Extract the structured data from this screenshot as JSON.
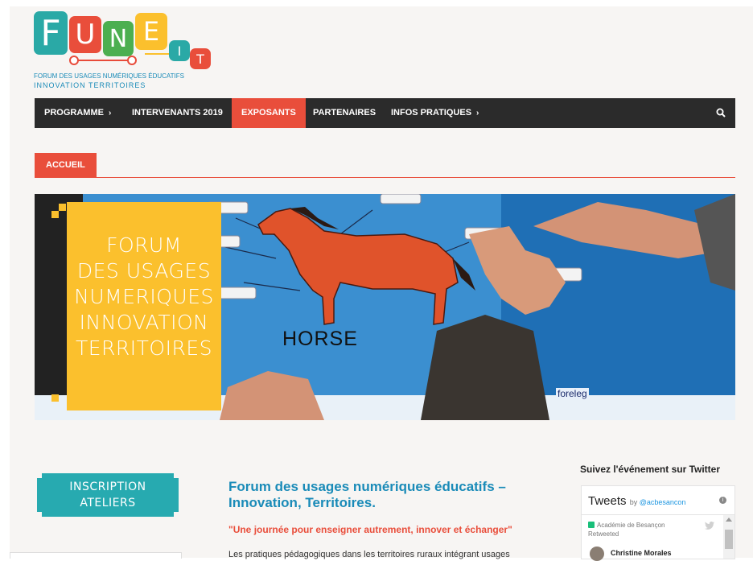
{
  "logo": {
    "letters": [
      "F",
      "U",
      "N",
      "E",
      "I",
      "T"
    ],
    "subtitle_line1": "FORUM DES USAGES NUMÉRIQUES ÉDUCATIFS",
    "subtitle_line2": "INNOVATION TERRITOIRES"
  },
  "nav": {
    "items": [
      {
        "label": "PROGRAMME",
        "has_submenu": true
      },
      {
        "label": "INTERVENANTS 2019",
        "has_submenu": false
      },
      {
        "label": "EXPOSANTS",
        "has_submenu": false,
        "active": true
      },
      {
        "label": "PARTENAIRES",
        "has_submenu": false
      },
      {
        "label": "INFOS PRATIQUES",
        "has_submenu": true
      }
    ],
    "chevron": "›",
    "search_icon": "search-icon"
  },
  "breadcrumb": {
    "label": "ACCUEIL"
  },
  "hero": {
    "lines": [
      "FORUM",
      "DES USAGES",
      "NUMERIQUES",
      "INNOVATION",
      "TERRITOIRES"
    ],
    "horse_word": "HORSE",
    "foreleg_word": "foreleg"
  },
  "inscription": {
    "line1": "INSCRIPTION",
    "line2": "ATELIERS"
  },
  "main": {
    "title": "Forum des usages numériques éducatifs – Innovation, Territoires.",
    "quote": "\"Une journée pour enseigner autrement, innover et échanger\"",
    "paragraph": "Les pratiques pédagogiques dans les territoires ruraux intégrant usages"
  },
  "twitter": {
    "heading": "Suivez l'événement sur Twitter",
    "title": "Tweets",
    "by": "by",
    "handle": "@acbesancon",
    "info": "i",
    "retweet_source": "Académie de Besançon",
    "retweet_label": "Retweeted",
    "author": "Christine Morales"
  },
  "colors": {
    "accent_red": "#e94e3b",
    "nav_bg": "#2b2b2b",
    "teal": "#27aab0",
    "blue_title": "#1a8bb8",
    "hero_yellow": "#fbc02d"
  }
}
